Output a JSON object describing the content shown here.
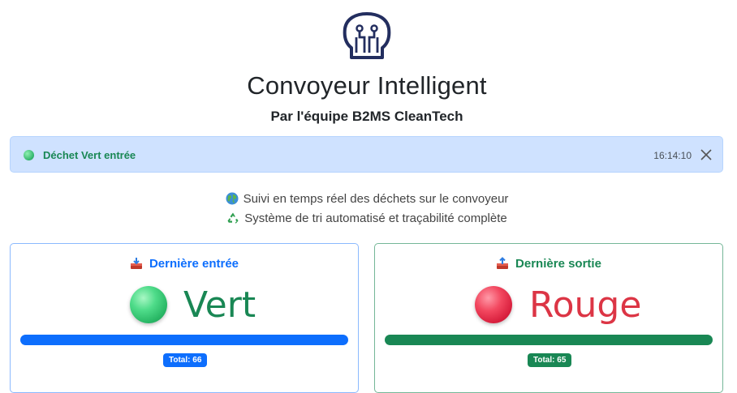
{
  "header": {
    "logo_icon": "circuit-brain-icon",
    "title": "Convoyeur Intelligent",
    "subtitle_prefix": "Par l'équipe ",
    "subtitle_team": "B2MS CleanTech"
  },
  "alert": {
    "message": "Déchet Vert entrée",
    "time": "16:14:10",
    "dot_color": "#2fb36a",
    "close_icon": "close-icon"
  },
  "info": {
    "line1": "Suivi en temps réel des déchets sur le convoyeur",
    "line1_icon": "globe-icon",
    "line2": "Système de tri automatisé et traçabilité complète",
    "line2_icon": "recycle-icon"
  },
  "cards": {
    "entry": {
      "title": "Dernière entrée",
      "icon": "inbox-tray-icon",
      "color_name": "Vert",
      "ball_color": "#2ab866",
      "bar_color": "#0d6efd",
      "total": "Total: 66"
    },
    "exit": {
      "title": "Dernière sortie",
      "icon": "outbox-tray-icon",
      "color_name": "Rouge",
      "ball_color": "#d81f3d",
      "bar_color": "#198754",
      "total": "Total: 65"
    }
  }
}
